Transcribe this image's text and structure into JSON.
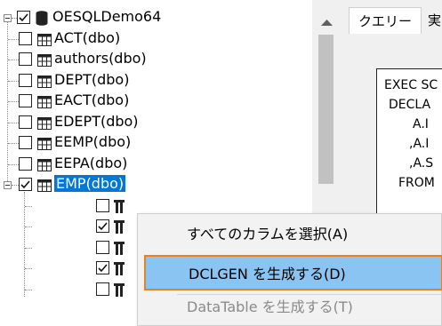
{
  "tree": {
    "database": {
      "label": "OESQLDemo64",
      "checked": true
    },
    "tables": [
      {
        "label": "ACT(dbo)",
        "checked": false
      },
      {
        "label": "authors(dbo)",
        "checked": false
      },
      {
        "label": "DEPT(dbo)",
        "checked": false
      },
      {
        "label": "EACT(dbo)",
        "checked": false
      },
      {
        "label": "EDEPT(dbo)",
        "checked": false
      },
      {
        "label": "EEMP(dbo)",
        "checked": false
      },
      {
        "label": "EEPA(dbo)",
        "checked": false
      },
      {
        "label": "EMP(dbo)",
        "checked": true,
        "selected": true
      }
    ],
    "columns": [
      {
        "checked": false
      },
      {
        "checked": true
      },
      {
        "checked": false
      },
      {
        "checked": true
      },
      {
        "checked": false
      }
    ]
  },
  "tabs": {
    "query": "クエリー",
    "next": "実"
  },
  "code_lines": [
    "EXEC SC",
    "DECLA",
    "A.I",
    ",A.I",
    ",A.S",
    "FROM"
  ],
  "context_menu": {
    "items": [
      {
        "label": "すべてのカラムを選択(A)",
        "enabled": true
      },
      {
        "label": "DCLGEN を生成する(D)",
        "enabled": true,
        "highlighted": true
      },
      {
        "label": "DataTable を生成する(T)",
        "enabled": false
      }
    ]
  },
  "colors": {
    "selection": "#0078d7",
    "menu_highlight": "#89c4f2",
    "highlight_border": "#e8821c"
  }
}
